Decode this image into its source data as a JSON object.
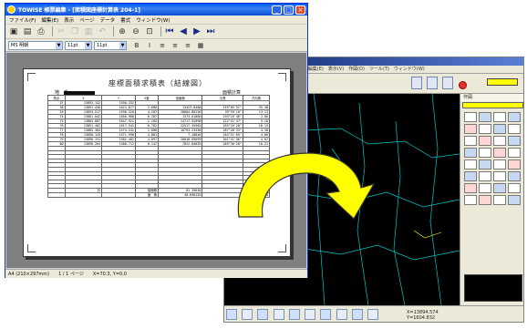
{
  "report_window": {
    "title": "TOWISE 帳票編集 - [面積図座標計算表 204-1]",
    "menu": [
      "ファイル(F)",
      "編集(E)",
      "表示",
      "ページ",
      "データ",
      "書式",
      "ウィンドウ(W)"
    ],
    "toolbar": {
      "font_name": "MS 明朝",
      "font_size": "11pt",
      "font_size2": "11pt",
      "bold": "B",
      "italic": "I"
    },
    "report": {
      "title": "座標面積求積表（結線図）",
      "header_left": "地　番",
      "header_right": "面積計算"
    },
    "table": {
      "header": [
        "測点",
        "X",
        "Y",
        "X差",
        "倍面積",
        "辺長",
        "方向角"
      ],
      "rows": [
        [
          "37",
          "13892.152",
          "1590.332",
          "",
          "",
          "",
          ""
        ],
        [
          "38",
          "13891.456",
          "1623.877",
          "2.680",
          "13423.8408",
          "159°05'52\"",
          "35.48 "
        ],
        [
          "39",
          "13893.517",
          "1596.320",
          "4.287",
          "28004.86256",
          "39°39'10\"",
          "13.13"
        ],
        [
          "74",
          "13881.042",
          "1656.988",
          "6.287",
          "1375.81880",
          "193°16'48\"",
          "2.06"
        ],
        [
          "75",
          "13883.887",
          "1647.921",
          "2.185",
          "24717.52898",
          "222°41'47\"",
          "3.18"
        ],
        [
          "76",
          "13891.462",
          "1617.541",
          "0.782",
          "22517.35965",
          "265°10'20\"",
          "10.15"
        ],
        [
          "77",
          "13885.384",
          "1574.541",
          "2.088",
          "10793.23438",
          "287°48'33\"",
          "4.38"
        ],
        [
          "78",
          "13890.145",
          "1571.998",
          "4.881",
          "7.18840",
          "264°51'05\"",
          "4.08"
        ],
        [
          "79",
          "13896.151",
          "1582.481",
          "4.097",
          "20018.69099",
          "301°41'36\"",
          "4.07"
        ],
        [
          "80",
          "13898.264",
          "1580.712",
          "0.147",
          "7022.84039",
          "289°36'28\"",
          "10.31"
        ],
        [
          "",
          "",
          "",
          "",
          "",
          "",
          ""
        ],
        [
          "",
          "",
          "",
          "",
          "",
          "",
          ""
        ],
        [
          "",
          "",
          "",
          "",
          "",
          "",
          ""
        ],
        [
          "",
          "",
          "",
          "",
          "",
          "",
          ""
        ],
        [
          "",
          "",
          "",
          "",
          "",
          "",
          ""
        ],
        [
          "",
          "",
          "",
          "",
          "",
          "",
          ""
        ],
        [
          "",
          "",
          "",
          "",
          "",
          "",
          ""
        ],
        [
          "",
          "",
          "",
          "",
          "",
          "",
          ""
        ],
        [
          "",
          "",
          "",
          "",
          "",
          "",
          ""
        ],
        [
          "",
          "",
          "",
          "",
          "",
          "",
          ""
        ]
      ],
      "totals": [
        [
          "",
          "計",
          "",
          "倍面積",
          "81.39630",
          "",
          ""
        ],
        [
          "",
          "",
          "",
          "面　積",
          "40.698155",
          "",
          "40.698"
        ]
      ]
    },
    "status": {
      "paper": "A4 (210×297mm)",
      "page": "1 / 1 ページ",
      "zoom": "X=70.3, Y=0.0"
    }
  },
  "cad_window": {
    "menu": "ファイル(F)　編集(E)　表示(V)　作図(D)　ツール(T)　ウィンドウ(W)",
    "panel_title": "作図",
    "coord_x": "X=13894.574",
    "coord_y": "Y=1604.832"
  },
  "colors": {
    "arrow_fill": "#ffff00",
    "title_bar": "#0058ee",
    "cad_background": "#000000",
    "cad_lines": "#00c8c8",
    "cad_highlight": "#ffff00"
  }
}
